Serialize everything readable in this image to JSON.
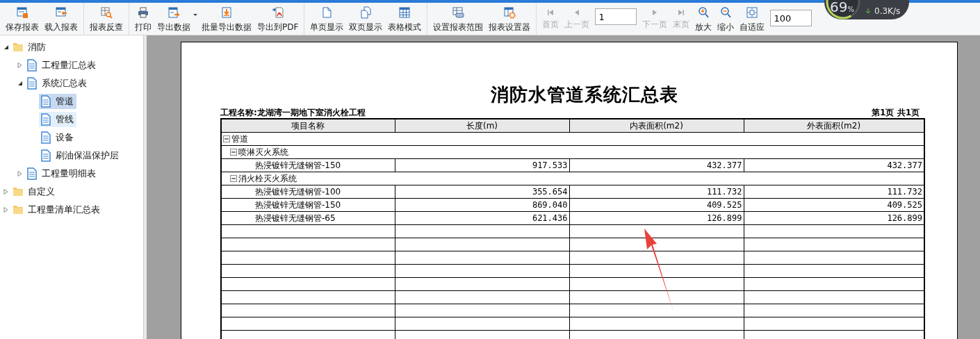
{
  "toolbar": {
    "groups": [
      [
        {
          "kind": "button",
          "label": "保存报表",
          "disabled": false
        },
        {
          "kind": "button",
          "label": "载入报表",
          "disabled": false
        }
      ],
      [
        {
          "kind": "button",
          "label": "报表反查",
          "disabled": false
        }
      ],
      [
        {
          "kind": "button",
          "label": "打印",
          "disabled": false
        },
        {
          "kind": "button",
          "label": "导出数据",
          "disabled": false,
          "has_menu": true
        },
        {
          "kind": "button",
          "label": "批量导出数据",
          "disabled": false
        },
        {
          "kind": "button",
          "label": "导出到PDF",
          "disabled": false
        }
      ],
      [
        {
          "kind": "button",
          "label": "单页显示",
          "disabled": false
        },
        {
          "kind": "button",
          "label": "双页显示",
          "disabled": false
        },
        {
          "kind": "button",
          "label": "表格模式",
          "disabled": false
        }
      ],
      [
        {
          "kind": "button",
          "label": "设置报表范围",
          "disabled": false
        },
        {
          "kind": "button",
          "label": "报表设置器",
          "disabled": false
        }
      ],
      [
        {
          "kind": "button",
          "label": "首页",
          "disabled": true
        },
        {
          "kind": "button",
          "label": "上一页",
          "disabled": true
        },
        {
          "kind": "field",
          "value": "1"
        },
        {
          "kind": "button",
          "label": "下一页",
          "disabled": true
        },
        {
          "kind": "button",
          "label": "末页",
          "disabled": true
        },
        {
          "kind": "button",
          "label": "放大",
          "disabled": false
        },
        {
          "kind": "button",
          "label": "缩小",
          "disabled": false
        },
        {
          "kind": "button",
          "label": "自适应",
          "disabled": false
        },
        {
          "kind": "field",
          "value": "100"
        }
      ]
    ]
  },
  "monitor": {
    "value": "69",
    "unit": "%",
    "speed": "0.3K/s"
  },
  "tree": [
    {
      "kind": "folder",
      "label": "消防",
      "expanded": true,
      "selected": false,
      "hovered": false,
      "children": [
        {
          "kind": "report",
          "label": "工程量汇总表",
          "expanded": false,
          "selected": false,
          "hovered": false
        },
        {
          "kind": "report",
          "label": "系统汇总表",
          "expanded": true,
          "selected": false,
          "hovered": false,
          "children": [
            {
              "kind": "report",
              "label": "管道",
              "selected": true,
              "hovered": false
            },
            {
              "kind": "report",
              "label": "管线",
              "selected": false,
              "hovered": true
            },
            {
              "kind": "report",
              "label": "设备",
              "selected": false,
              "hovered": false
            },
            {
              "kind": "report",
              "label": "刷油保温保护层",
              "selected": false,
              "hovered": false
            }
          ]
        },
        {
          "kind": "report",
          "label": "工程量明细表",
          "expanded": false,
          "selected": false,
          "hovered": false
        }
      ]
    },
    {
      "kind": "folder",
      "label": "自定义",
      "expanded": false,
      "selected": false,
      "hovered": false
    },
    {
      "kind": "folder",
      "label": "工程量清单汇总表",
      "expanded": false,
      "selected": false,
      "hovered": false
    }
  ],
  "report": {
    "title": "消防水管道系统汇总表",
    "project": "工程名称:龙湖湾一期地下室消火栓工程",
    "page_info": "第1页  共1页",
    "columns": [
      "项目名称",
      "长度(m)",
      "内表面积(m2)",
      "外表面积(m2)"
    ],
    "rows": [
      {
        "name": "管道",
        "expanded": true,
        "children": [
          {
            "name": "喷淋灭火系统",
            "expanded": true,
            "children": [
              {
                "name": "热浸镀锌无缝钢管-150",
                "values": [
                  "917.533",
                  "432.377",
                  "432.377"
                ]
              }
            ]
          },
          {
            "name": "消火栓灭火系统",
            "expanded": true,
            "children": [
              {
                "name": "热浸镀锌无缝钢管-100",
                "values": [
                  "355.654",
                  "111.732",
                  "111.732"
                ]
              },
              {
                "name": "热浸镀锌无缝钢管-150",
                "values": [
                  "869.040",
                  "409.525",
                  "409.525"
                ]
              },
              {
                "name": "热浸镀锌无缝钢管-65",
                "values": [
                  "621.436",
                  "126.899",
                  "126.899"
                ]
              }
            ]
          }
        ]
      }
    ]
  }
}
